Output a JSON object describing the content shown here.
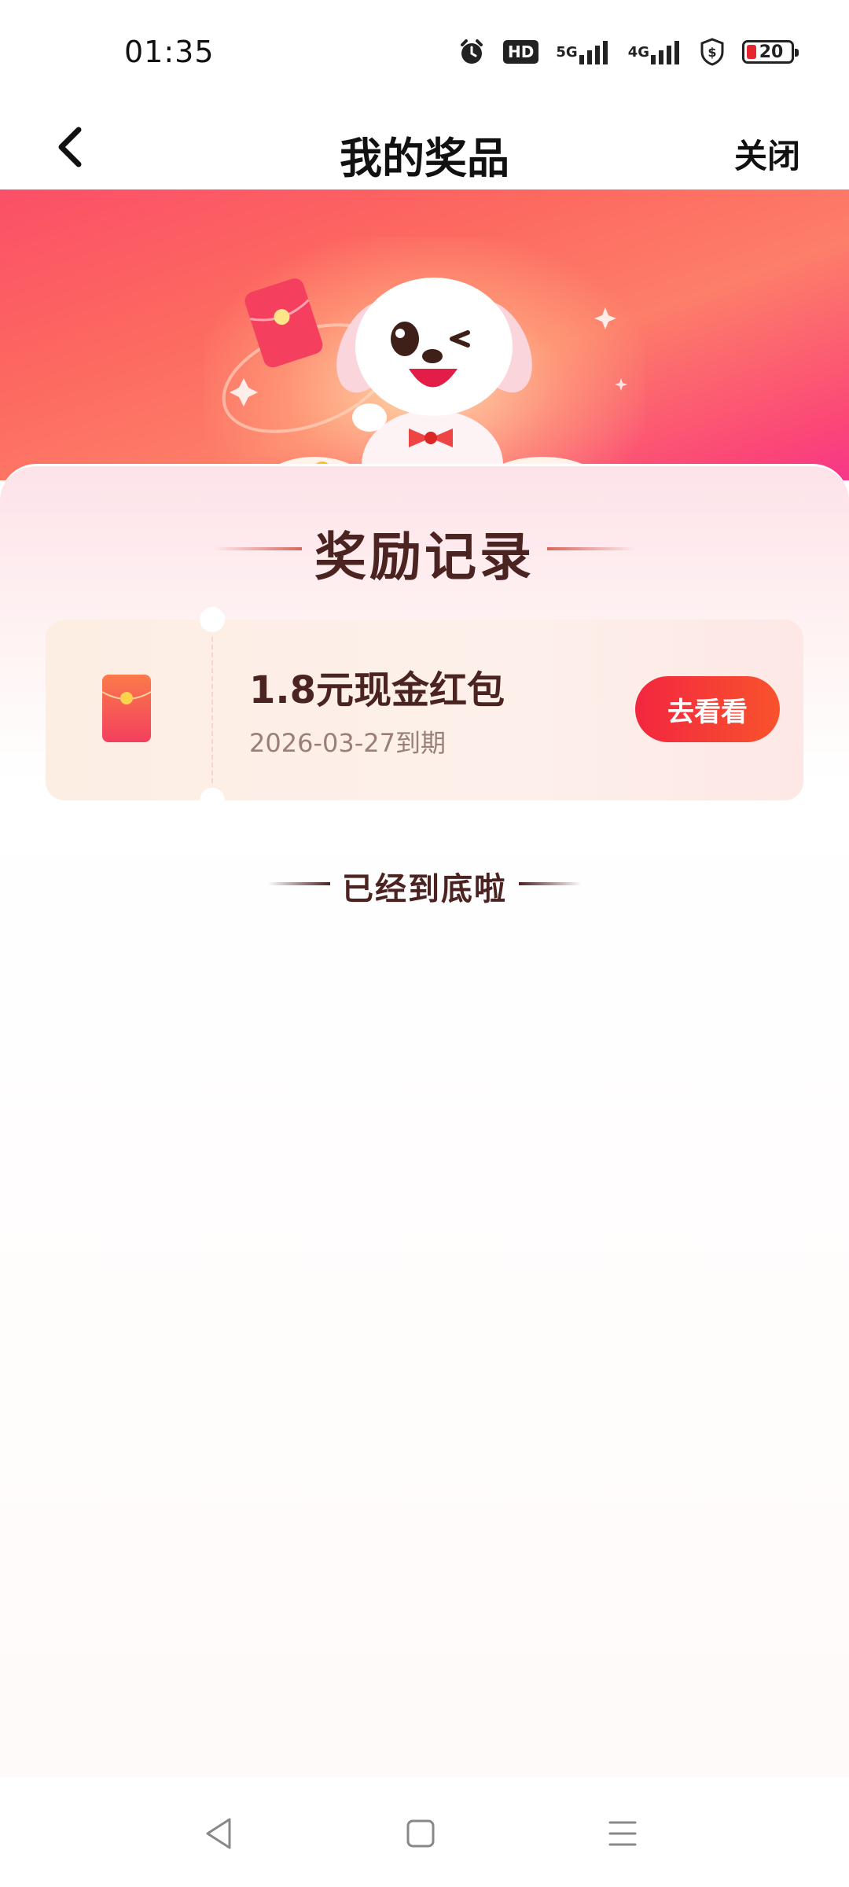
{
  "status_bar": {
    "time": "01:35",
    "icons": [
      "alarm-icon",
      "hd-badge",
      "5g-signal-icon",
      "4g-signal-icon",
      "shield-icon",
      "battery-icon"
    ],
    "hd_label": "HD",
    "net1_label": "5G",
    "net2_label": "4G",
    "battery_level": "20",
    "battery_color": "#e5262f"
  },
  "nav": {
    "title": "我的奖品",
    "close_label": "关闭"
  },
  "section": {
    "title": "奖励记录"
  },
  "rewards": [
    {
      "name": "1.8元现金红包",
      "expiry": "2026-03-27到期",
      "action_label": "去看看",
      "icon": "red-packet-icon"
    }
  ],
  "footer": {
    "end_text": "已经到底啦"
  },
  "colors": {
    "accent": "#f3263f",
    "title_text": "#4b2320",
    "banner_pink": "#fb4f67"
  }
}
